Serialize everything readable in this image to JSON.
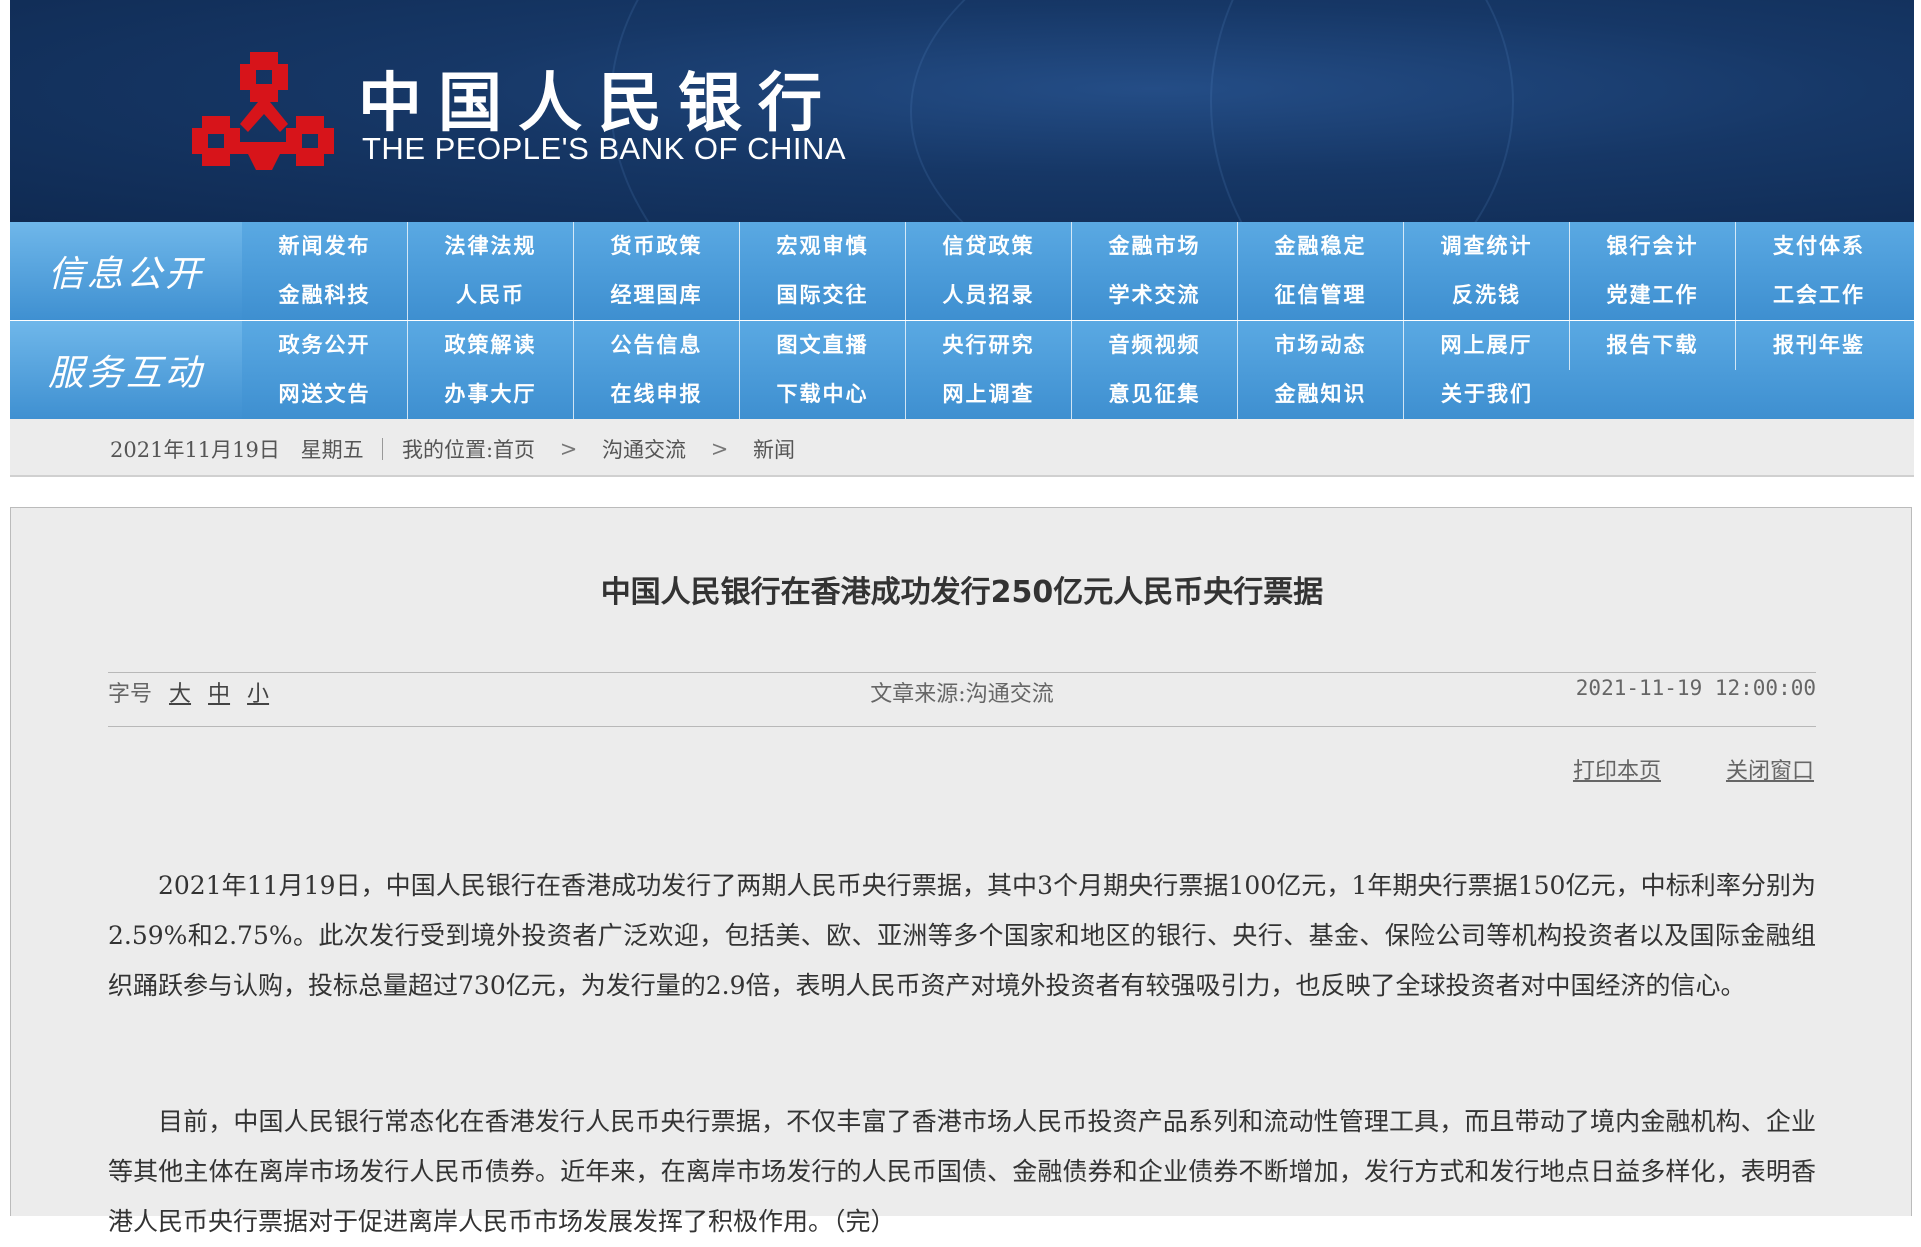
{
  "header": {
    "logo_cn": "中国人民银行",
    "logo_en": "THE PEOPLE'S BANK OF CHINA",
    "emblem_icon": "pboc-emblem-icon",
    "emblem_color": "#d7141a"
  },
  "nav": {
    "info": {
      "title": "信息公开",
      "row1": [
        "新闻发布",
        "法律法规",
        "货币政策",
        "宏观审慎",
        "信贷政策",
        "金融市场",
        "金融稳定",
        "调查统计",
        "银行会计",
        "支付体系"
      ],
      "row2": [
        "金融科技",
        "人民币",
        "经理国库",
        "国际交往",
        "人员招录",
        "学术交流",
        "征信管理",
        "反洗钱",
        "党建工作",
        "工会工作"
      ]
    },
    "service": {
      "title": "服务互动",
      "row1": [
        "政务公开",
        "政策解读",
        "公告信息",
        "图文直播",
        "央行研究",
        "音频视频",
        "市场动态",
        "网上展厅",
        "报告下载",
        "报刊年鉴"
      ],
      "row2": [
        "网送文告",
        "办事大厅",
        "在线申报",
        "下载中心",
        "网上调查",
        "意见征集",
        "金融知识",
        "关于我们"
      ]
    }
  },
  "breadcrumb": {
    "date": "2021年11月19日",
    "weekday": "星期五",
    "location_label": "我的位置:",
    "home": "首页",
    "level1": "沟通交流",
    "level2": "新闻"
  },
  "article": {
    "title": "中国人民银行在香港成功发行250亿元人民币央行票据",
    "font_label": "字号",
    "font_large": "大",
    "font_medium": "中",
    "font_small": "小",
    "source_label": "文章来源:",
    "source_value": "沟通交流",
    "datetime": "2021-11-19 12:00:00",
    "print_label": "打印本页",
    "close_label": "关闭窗口",
    "paragraphs": [
      "2021年11月19日，中国人民银行在香港成功发行了两期人民币央行票据，其中3个月期央行票据100亿元，1年期央行票据150亿元，中标利率分别为2.59%和2.75%。此次发行受到境外投资者广泛欢迎，包括美、欧、亚洲等多个国家和地区的银行、央行、基金、保险公司等机构投资者以及国际金融组织踊跃参与认购，投标总量超过730亿元，为发行量的2.9倍，表明人民币资产对境外投资者有较强吸引力，也反映了全球投资者对中国经济的信心。",
      "目前，中国人民银行常态化在香港发行人民币央行票据，不仅丰富了香港市场人民币投资产品系列和流动性管理工具，而且带动了境内金融机构、企业等其他主体在离岸市场发行人民币债券。近年来，在离岸市场发行的人民币国债、金融债券和企业债券不断增加，发行方式和发行地点日益多样化，表明香港人民币央行票据对于促进离岸人民币市场发展发挥了积极作用。（完）"
    ]
  }
}
